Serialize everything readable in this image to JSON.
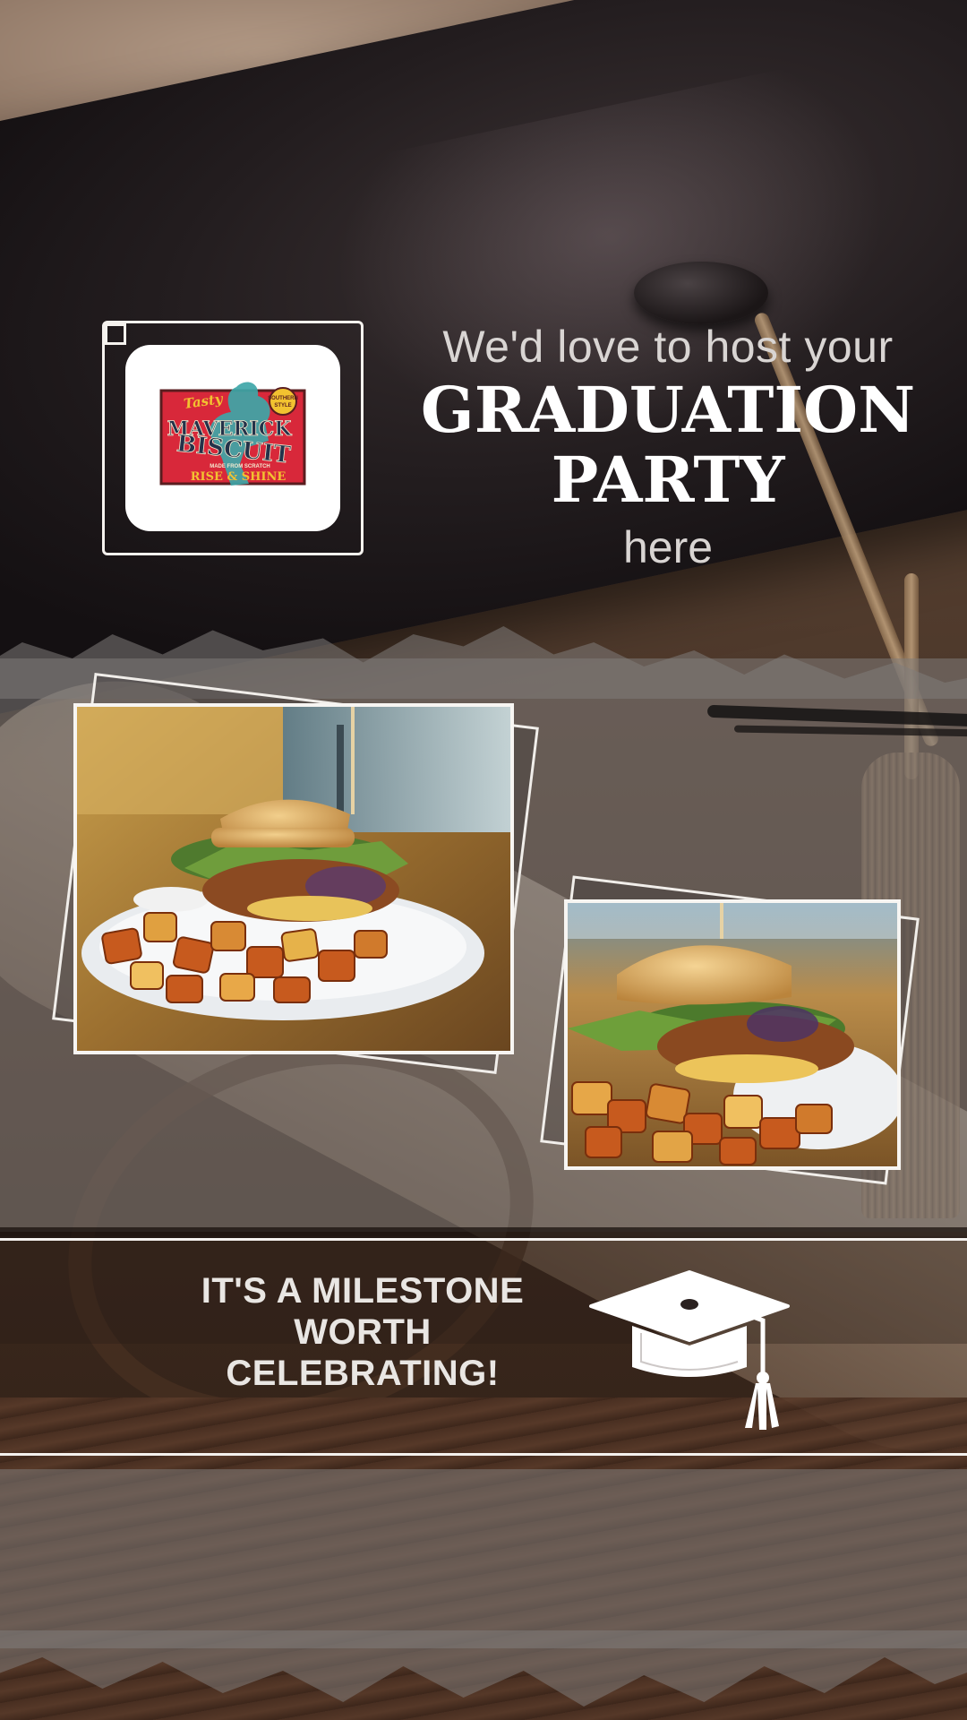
{
  "brand": {
    "logo_name": "Maverick Biscuit",
    "logo_text": {
      "top": "Tasty",
      "line1": "MAVERICK",
      "line2": "BISCUIT",
      "small": "MADE FROM SCRATCH",
      "bottom": "RISE & SHINE",
      "badge": "SOUTHERN STYLE"
    }
  },
  "headline": {
    "top": "We'd love to host your",
    "title_line1": "GRADUATION",
    "title_line2": "PARTY",
    "bottom": "here"
  },
  "milestone": {
    "line1": "IT'S A MILESTONE",
    "line2": "WORTH",
    "line3": "CELEBRATING!"
  },
  "icons": {
    "graduation_cap": "graduation-cap-icon"
  },
  "colors": {
    "text_white": "#ffffff",
    "text_soft": "#d9d5d3",
    "overlay_gray": "#807c7a",
    "cap_black": "#1b1617",
    "logo_red": "#d8283a",
    "logo_teal": "#3ea6a8",
    "logo_yellow": "#f2c230"
  }
}
